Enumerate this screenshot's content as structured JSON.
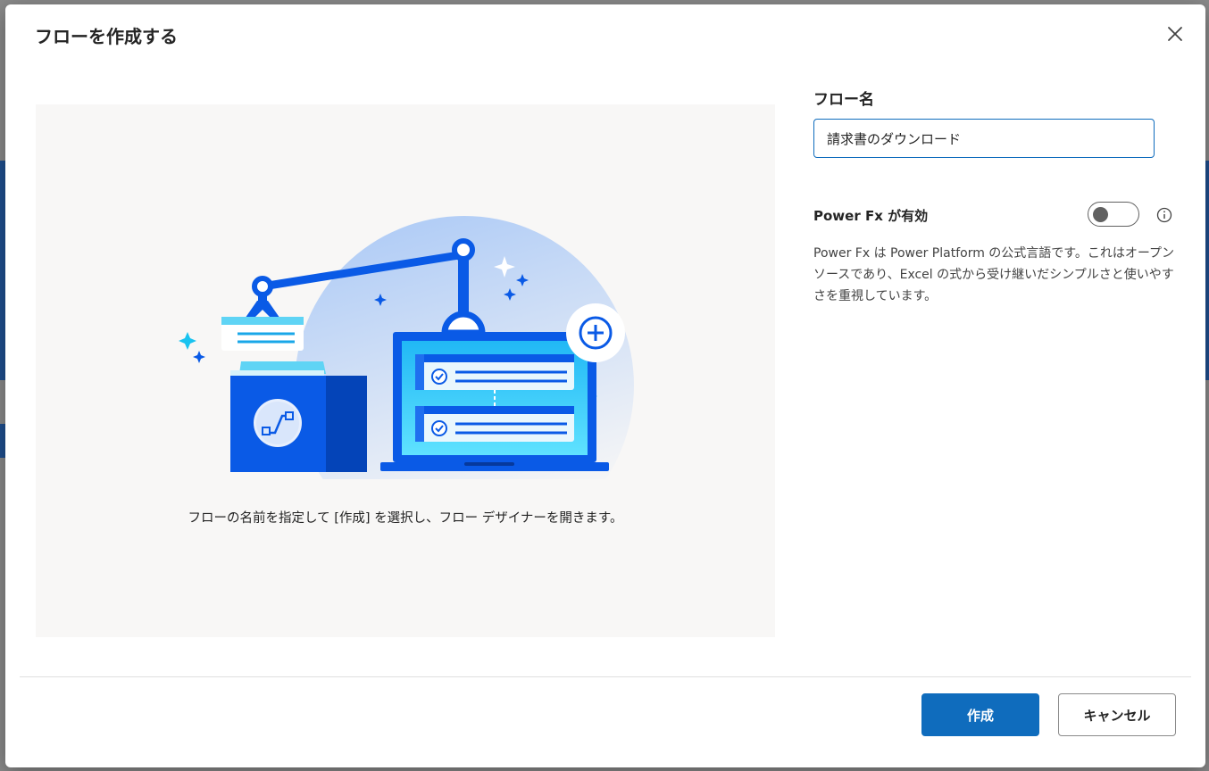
{
  "dialog": {
    "title": "フローを作成する",
    "close_icon": "close-icon"
  },
  "illustration": {
    "caption": "フローの名前を指定して [作成] を選択し、フロー デザイナーを開きます。",
    "colors": {
      "brand_blue": "#0f6cbd",
      "illustration_blue": "#0a5ae6",
      "accent_cyan": "#19c3f0",
      "circle_light": "#c7dcfb"
    }
  },
  "form": {
    "name_label": "フロー名",
    "name_value": "請求書のダウンロード",
    "powerfx_label": "Power Fx が有効",
    "powerfx_enabled": false,
    "info_icon": "info-icon",
    "powerfx_description": "Power Fx は Power Platform の公式言語です。これはオープンソースであり、Excel の式から受け継いだシンプルさと使いやすさを重視しています。"
  },
  "footer": {
    "create_label": "作成",
    "cancel_label": "キャンセル"
  }
}
